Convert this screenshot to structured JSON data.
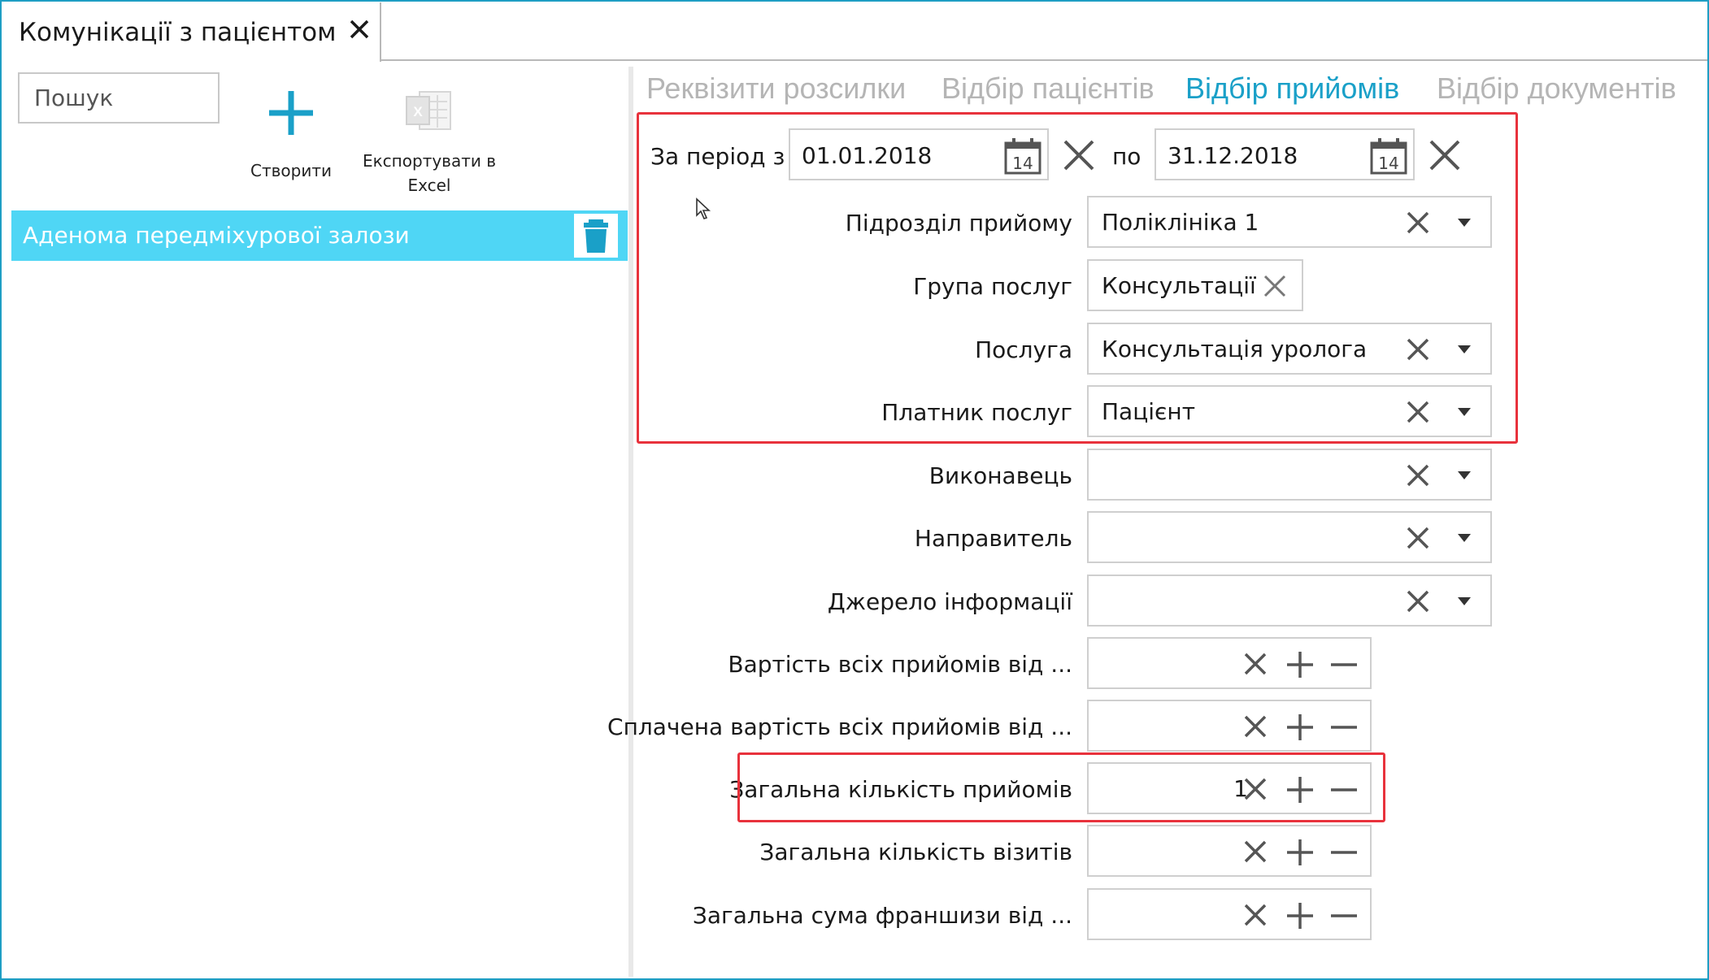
{
  "tab": {
    "title": "Комунікації з пацієнтом"
  },
  "left": {
    "search_placeholder": "Пошук",
    "create_label": "Створити",
    "export_label_1": "Експортувати в",
    "export_label_2": "Excel",
    "items": [
      {
        "label": "Аденома передміхурової залози"
      }
    ]
  },
  "subtabs": [
    {
      "label": "Реквізити розсилки",
      "active": false
    },
    {
      "label": "Відбір пацієнтів",
      "active": false
    },
    {
      "label": "Відбір прийомів",
      "active": true
    },
    {
      "label": "Відбір документів",
      "active": false
    }
  ],
  "period": {
    "from_label": "За період з",
    "from_value": "01.01.2018",
    "to_label": "по",
    "to_value": "31.12.2018",
    "calendar_day": "14"
  },
  "fields": {
    "department": {
      "label": "Підрозділ прийому",
      "value": "Поліклініка 1"
    },
    "service_group": {
      "label": "Група послуг",
      "value": "Консультації"
    },
    "service": {
      "label": "Послуга",
      "value": "Консультація уролога"
    },
    "payer": {
      "label": "Платник послуг",
      "value": "Пацієнт"
    },
    "performer": {
      "label": "Виконавець",
      "value": ""
    },
    "referrer": {
      "label": "Направитель",
      "value": ""
    },
    "info_source": {
      "label": "Джерело інформації",
      "value": ""
    },
    "cost_all": {
      "label": "Вартість всіх прийомів від ...",
      "value": ""
    },
    "paid_all": {
      "label": "Сплачена вартість всіх прийомів від ...",
      "value": ""
    },
    "total_visits_count": {
      "label": "Загальна кількість прийомів",
      "value": "1"
    },
    "total_visits": {
      "label": "Загальна кількість візитів",
      "value": ""
    },
    "franchise_sum": {
      "label": "Загальна сума франшизи від ...",
      "value": ""
    }
  },
  "colors": {
    "accent": "#1aa0c8",
    "selected": "#4fd6f5",
    "highlight": "#e8323c"
  }
}
